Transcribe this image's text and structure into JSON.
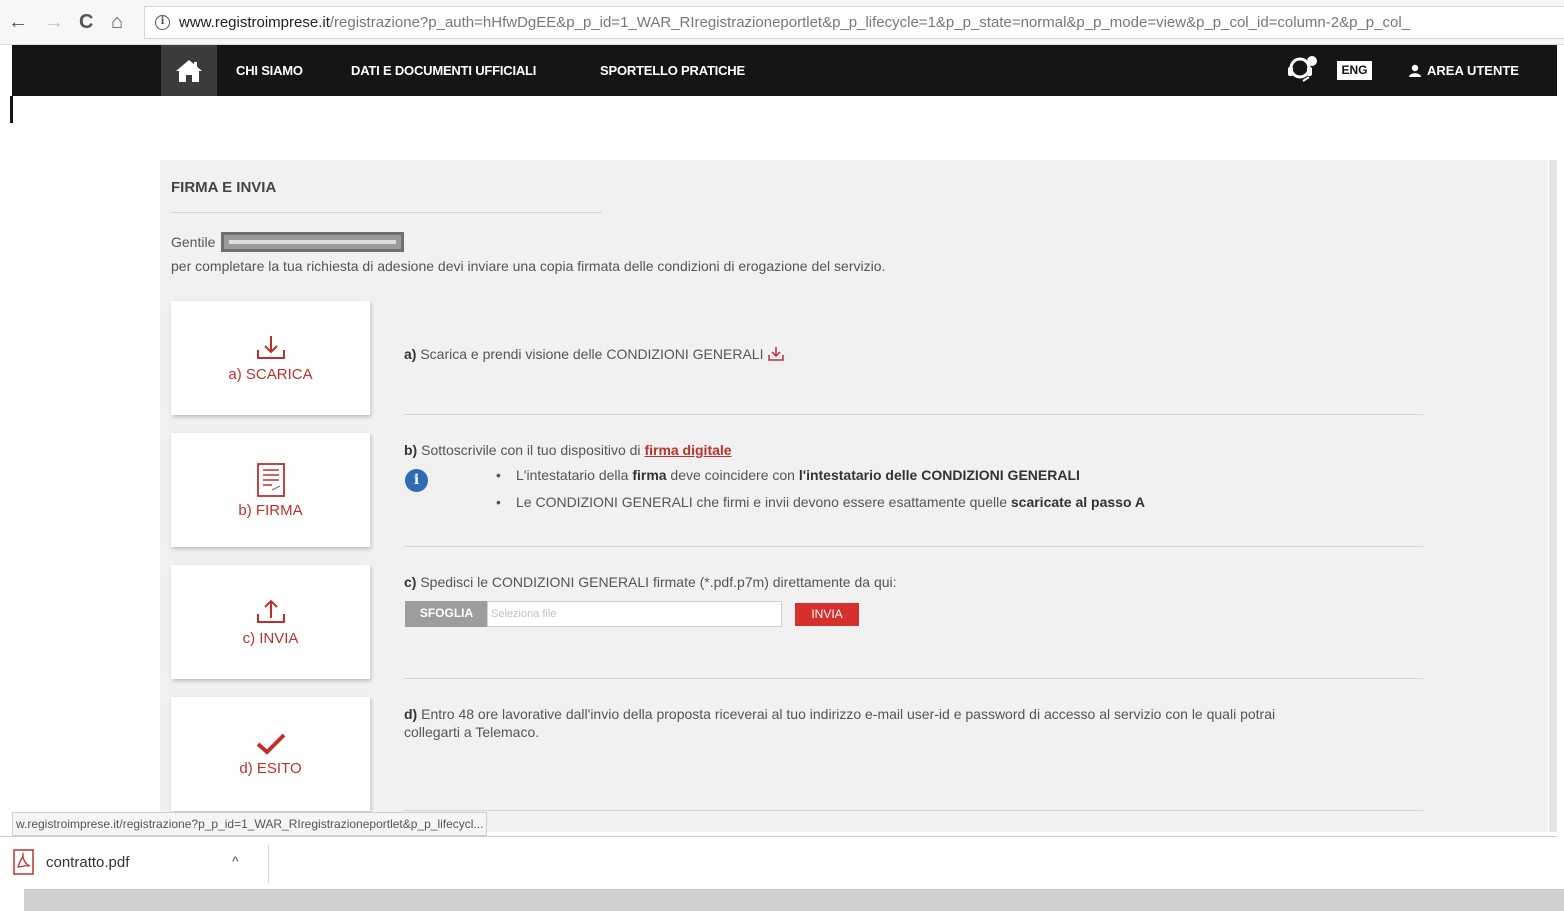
{
  "browser": {
    "back_icon": "←",
    "forward_icon": "→",
    "reload_icon": "C",
    "home_icon": "⌂",
    "url_domain": "www.registroimprese.it",
    "url_path": "/registrazione?p_auth=hHfwDgEE&p_p_id=1_WAR_RIregistrazioneportlet&p_p_lifecycle=1&p_p_state=normal&p_p_mode=view&p_p_col_id=column-2&p_p_col_"
  },
  "header": {
    "nav": [
      "CHI SIAMO",
      "DATI E DOCUMENTI UFFICIALI",
      "SPORTELLO PRATICHE"
    ],
    "lang": "ENG",
    "user_area": "AREA UTENTE"
  },
  "main": {
    "title": "FIRMA E INVIA",
    "greeting": "Gentile",
    "intro": "per completare la tua richiesta di adesione devi inviare una copia firmata delle condizioni di erogazione del servizio.",
    "cards": [
      {
        "label": "a) SCARICA",
        "icon": "download-icon"
      },
      {
        "label": "b) FIRMA",
        "icon": "document-sign-icon"
      },
      {
        "label": "c) INVIA",
        "icon": "upload-icon"
      },
      {
        "label": "d) ESITO",
        "icon": "checkmark-icon"
      }
    ],
    "step_a": {
      "prefix": "a)",
      "text": " Scarica e prendi visione delle CONDIZIONI GENERALI"
    },
    "step_b": {
      "prefix": "b)",
      "text": " Sottoscrivile con il tuo dispositivo di ",
      "link": "firma digitale",
      "bullet1_a": "L'intestatario della ",
      "bullet1_b": "firma",
      "bullet1_c": " deve coincidere con ",
      "bullet1_d": "l'intestatario delle CONDIZIONI GENERALI",
      "bullet2_a": "Le CONDIZIONI GENERALI che firmi e invii devono essere esattamente quelle ",
      "bullet2_b": "scaricate al passo A"
    },
    "step_c": {
      "prefix": "c)",
      "text": " Spedisci le CONDIZIONI GENERALI firmate (*.pdf.p7m) direttamente da qui:",
      "browse": "SFOGLIA",
      "file_placeholder": "Seleziona file",
      "send": "INVIA"
    },
    "step_d": {
      "prefix": "d)",
      "line1": " Entro 48 ore lavorative dall'invio della proposta riceverai al tuo indirizzo e-mail user-id e password di accesso al servizio con le quali potrai",
      "line2": "collegarti a Telemaco."
    }
  },
  "status_url": "w.registroimprese.it/registrazione?p_p_id=1_WAR_RIregistrazioneportlet&p_p_lifecycl...",
  "downloads": {
    "file": "contratto.pdf",
    "chevron": "^"
  },
  "colors": {
    "accent_red": "#c0302a",
    "header_bg": "#151515",
    "info_blue": "#2f6cb3"
  }
}
